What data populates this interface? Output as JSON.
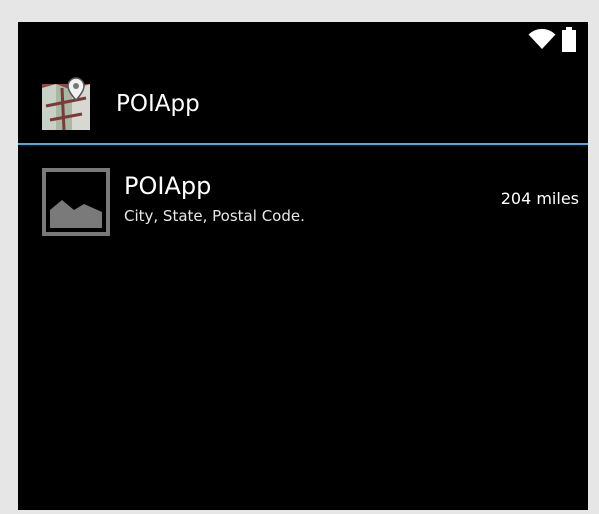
{
  "status_bar": {
    "icons": [
      "wifi-icon",
      "battery-icon"
    ]
  },
  "action_bar": {
    "app_icon": "map-pin-icon",
    "title": "POIApp"
  },
  "colors": {
    "background": "#000000",
    "accent_divider": "#33b5e5",
    "thumbnail_gray": "#7a7a7a"
  },
  "poi_list": {
    "items": [
      {
        "name": "POIApp",
        "address": "City, State, Postal Code.",
        "distance": "204 miles",
        "thumbnail": "image-placeholder-icon"
      }
    ]
  }
}
